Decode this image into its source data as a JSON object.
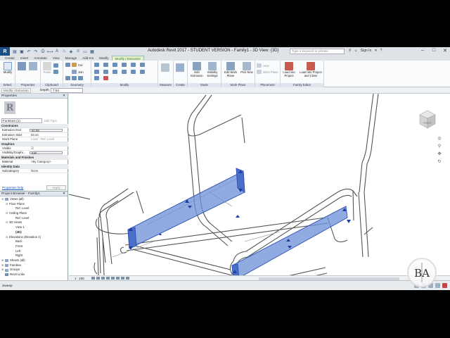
{
  "app": {
    "title": "Autodesk Revit 2017 - STUDENT VERSION -   Family1 - 3D View: {3D}",
    "search_placeholder": "Type a keyword or phrase",
    "signin": "Sign In",
    "logo": "R"
  },
  "tabs": [
    {
      "label": "Create"
    },
    {
      "label": "Insert"
    },
    {
      "label": "Annotate"
    },
    {
      "label": "View"
    },
    {
      "label": "Manage"
    },
    {
      "label": "Add-Ins"
    },
    {
      "label": "Modify"
    },
    {
      "label": "Modify | Extrusion"
    }
  ],
  "ribbon": {
    "modify": "Modify",
    "paste": "Paste",
    "cut": "Cut",
    "join": "Join",
    "edit_extrusion": "Edit Extrusion",
    "visibility_settings": "Visibility Settings",
    "edit_work_plane": "Edit Work Plane",
    "pick_new": "Pick New",
    "host": "Host",
    "work_plane": "Work Plane",
    "load_into_project": "Load into Project",
    "load_into_project_close": "Load into Project and Close",
    "panels": {
      "select": "Select",
      "properties": "Properties",
      "clipboard": "Clipboard",
      "geometry": "Geometry",
      "modify": "Modify",
      "measure": "Measure",
      "create": "Create",
      "mode": "Mode",
      "work_plane": "Work Plane",
      "placement": "Placement",
      "family_editor": "Family Editor"
    }
  },
  "options_bar": {
    "select_label": "Modify | Extrusion",
    "depth_label": "Depth",
    "depth_value": "7.54"
  },
  "properties": {
    "header": "Properties",
    "type_selector": "Furniture (1)",
    "edit_type": "Edit Type",
    "groups": {
      "constraints": "Constraints",
      "graphics": "Graphics",
      "materials": "Materials and Finishes",
      "identity": "Identity Data"
    },
    "rows": {
      "extrusion_end_label": "Extrusion End",
      "extrusion_end_value": "60.98",
      "extrusion_start_label": "Extrusion Start",
      "extrusion_start_value": "53.44",
      "work_plane_label": "Work Plane",
      "work_plane_value": "Level : Ref. Level",
      "visible_label": "Visible",
      "visibility_label": "Visibility/Graphi...",
      "visibility_value": "Edit...",
      "material_label": "Material",
      "material_value": "<By Category>",
      "subcategory_label": "Subcategory",
      "subcategory_value": "None"
    },
    "help_link": "Properties help",
    "apply": "Apply"
  },
  "browser": {
    "header": "Project Browser - Family1",
    "nodes": [
      {
        "label": "Views (all)"
      },
      {
        "label": "Floor Plans"
      },
      {
        "label": "Ref. Level"
      },
      {
        "label": "Ceiling Plans"
      },
      {
        "label": "Ref. Level"
      },
      {
        "label": "3D Views"
      },
      {
        "label": "View 1"
      },
      {
        "label": "{3D}"
      },
      {
        "label": "Elevations (Elevation 1)"
      },
      {
        "label": "Back"
      },
      {
        "label": "Front"
      },
      {
        "label": "Left"
      },
      {
        "label": "Right"
      },
      {
        "label": "Sheets (all)"
      },
      {
        "label": "Families"
      },
      {
        "label": "Groups"
      },
      {
        "label": "Revit Links"
      }
    ]
  },
  "viewcube": {
    "label": "FRONT"
  },
  "view_scale": "1 : 100",
  "status": "Sweep",
  "watermark": "BA",
  "colors": {
    "accent": "#1c4e8a",
    "selection": "#4a74c9",
    "contextual_tab": "#e8f3cc"
  }
}
